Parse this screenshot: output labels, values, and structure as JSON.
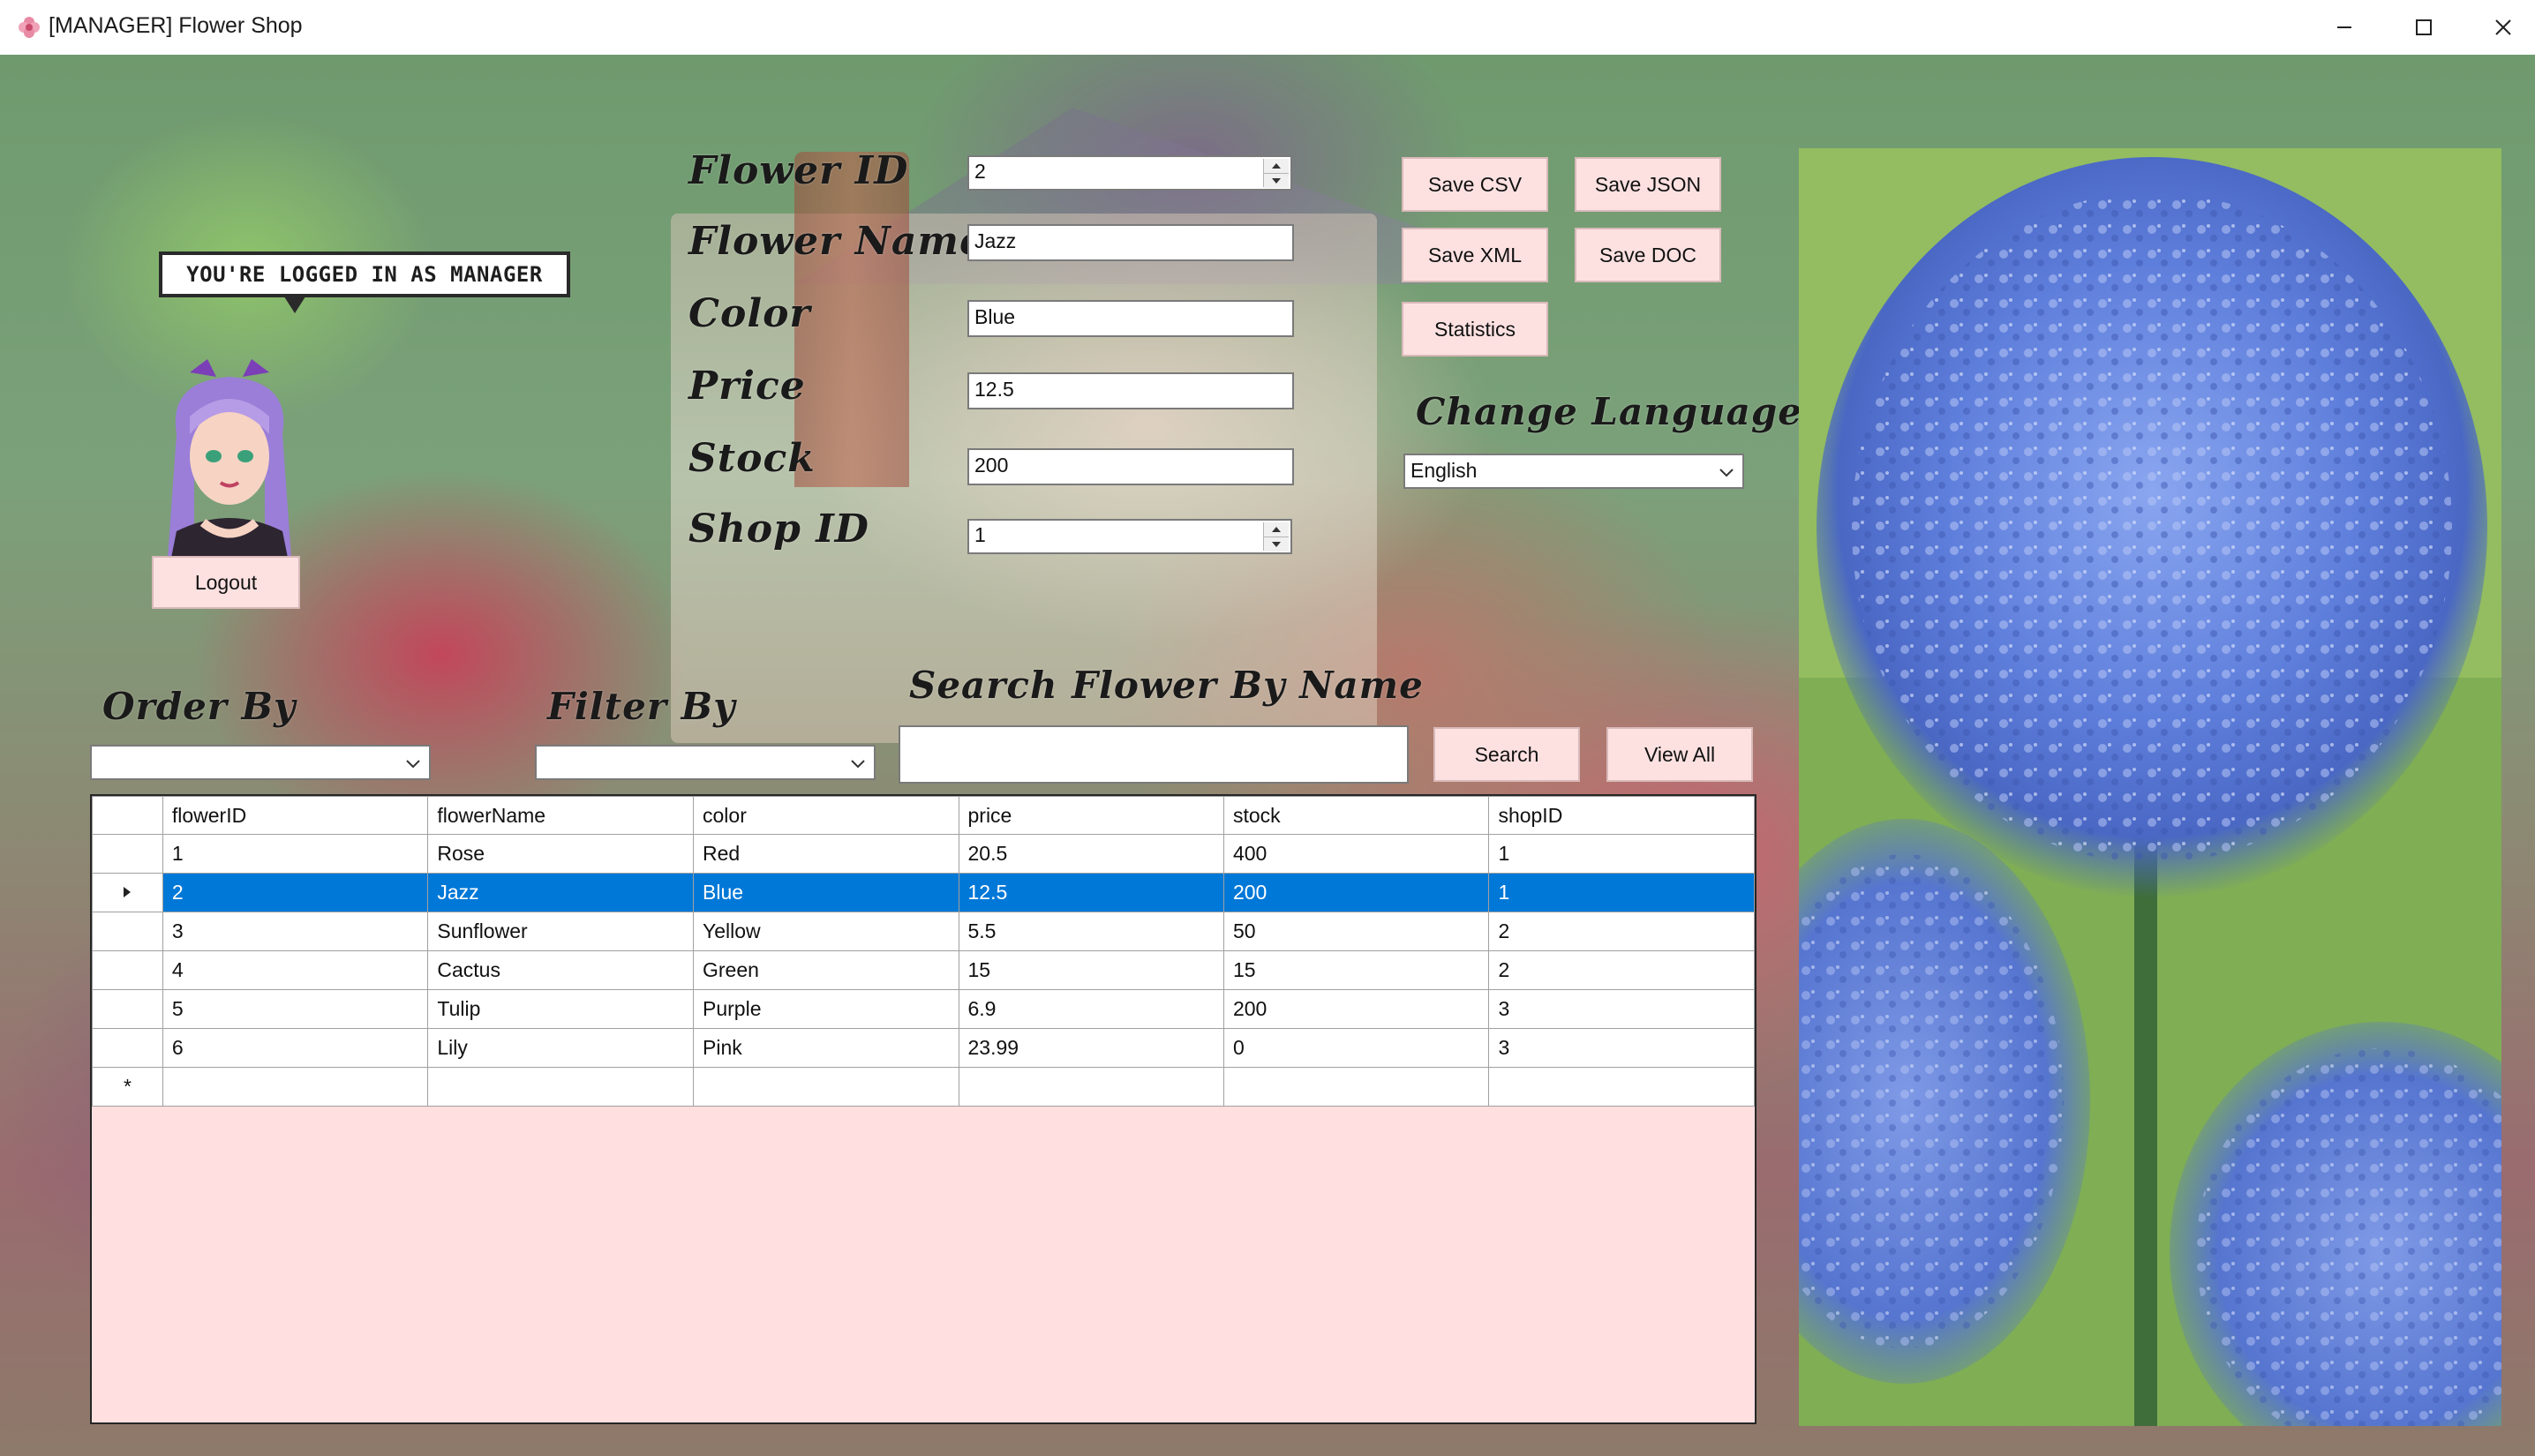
{
  "window": {
    "title": "[MANAGER] Flower Shop",
    "icon": "flower-app-icon",
    "controls": [
      "minimize-icon",
      "maximize-icon",
      "close-icon"
    ]
  },
  "login": {
    "bubble_text": "YOU'RE LOGGED IN AS MANAGER",
    "logout_label": "Logout"
  },
  "form": {
    "flower_id_label": "Flower ID",
    "flower_id_value": "2",
    "flower_name_label": "Flower Name",
    "flower_name_value": "Jazz",
    "color_label": "Color",
    "color_value": "Blue",
    "price_label": "Price",
    "price_value": "12.5",
    "stock_label": "Stock",
    "stock_value": "200",
    "shop_id_label": "Shop ID",
    "shop_id_value": "1"
  },
  "actions": {
    "save_csv": "Save CSV",
    "save_json": "Save JSON",
    "save_xml": "Save XML",
    "save_doc": "Save DOC",
    "statistics": "Statistics"
  },
  "language": {
    "label": "Change Language",
    "selected": "English"
  },
  "toolbar": {
    "order_by_label": "Order By",
    "order_by_value": "",
    "filter_by_label": "Filter By",
    "filter_by_value": "",
    "search_label": "Search Flower By Name",
    "search_value": "",
    "search_button": "Search",
    "view_all_button": "View All"
  },
  "grid": {
    "columns": [
      "flowerID",
      "flowerName",
      "color",
      "price",
      "stock",
      "shopID"
    ],
    "rows": [
      [
        "1",
        "Rose",
        "Red",
        "20.5",
        "400",
        "1"
      ],
      [
        "2",
        "Jazz",
        "Blue",
        "12.5",
        "200",
        "1"
      ],
      [
        "3",
        "Sunflower",
        "Yellow",
        "5.5",
        "50",
        "2"
      ],
      [
        "4",
        "Cactus",
        "Green",
        "15",
        "15",
        "2"
      ],
      [
        "5",
        "Tulip",
        "Purple",
        "6.9",
        "200",
        "3"
      ],
      [
        "6",
        "Lily",
        "Pink",
        "23.99",
        "0",
        "3"
      ]
    ],
    "selected_row_index": 1,
    "new_row_marker": "*"
  },
  "colors": {
    "button_bg": "#fde1e1",
    "grid_bg": "#ffdfdf",
    "selection": "#0078d7"
  }
}
